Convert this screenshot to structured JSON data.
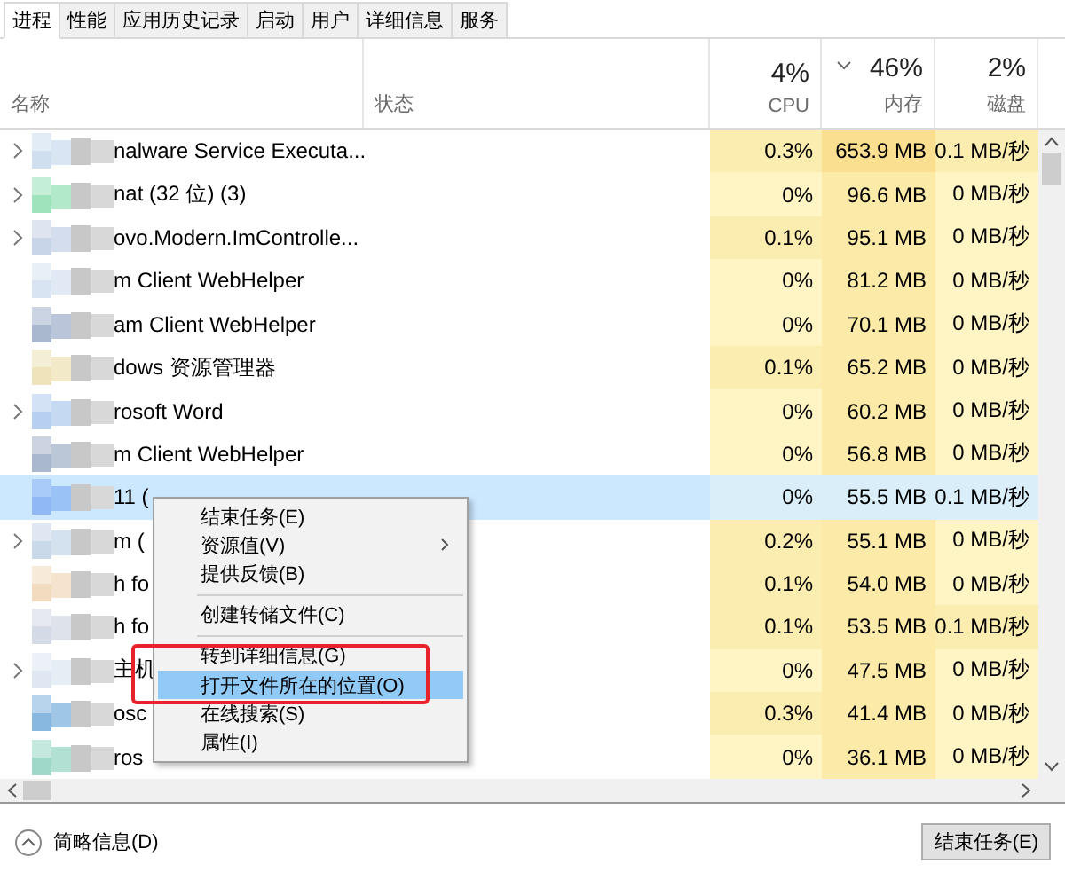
{
  "tabs": [
    {
      "label": "进程",
      "selected": true
    },
    {
      "label": "性能",
      "selected": false
    },
    {
      "label": "应用历史记录",
      "selected": false
    },
    {
      "label": "启动",
      "selected": false
    },
    {
      "label": "用户",
      "selected": false
    },
    {
      "label": "详细信息",
      "selected": false
    },
    {
      "label": "服务",
      "selected": false
    }
  ],
  "columns": {
    "name": "名称",
    "status": "状态",
    "metrics": [
      {
        "percent": "4%",
        "label": "CPU",
        "sorted": false
      },
      {
        "percent": "46%",
        "label": "内存",
        "sorted": true
      },
      {
        "percent": "2%",
        "label": "磁盘",
        "sorted": false
      }
    ]
  },
  "rows": [
    {
      "expandable": true,
      "name": "nalware Service Executa...",
      "selected": false,
      "cpu": "0.3%",
      "memory": "653.9 MB",
      "disk": "0.1 MB/秒"
    },
    {
      "expandable": true,
      "name": "nat (32 位) (3)",
      "selected": false,
      "cpu": "0%",
      "memory": "96.6 MB",
      "disk": "0 MB/秒"
    },
    {
      "expandable": true,
      "name": "ovo.Modern.ImControlle...",
      "selected": false,
      "cpu": "0.1%",
      "memory": "95.1 MB",
      "disk": "0 MB/秒"
    },
    {
      "expandable": false,
      "name": "m Client WebHelper",
      "selected": false,
      "cpu": "0%",
      "memory": "81.2 MB",
      "disk": "0 MB/秒"
    },
    {
      "expandable": false,
      "name": "am Client WebHelper",
      "selected": false,
      "cpu": "0%",
      "memory": "70.1 MB",
      "disk": "0 MB/秒"
    },
    {
      "expandable": false,
      "name": "dows 资源管理器",
      "selected": false,
      "cpu": "0.1%",
      "memory": "65.2 MB",
      "disk": "0 MB/秒"
    },
    {
      "expandable": true,
      "name": "rosoft Word",
      "selected": false,
      "cpu": "0%",
      "memory": "60.2 MB",
      "disk": "0 MB/秒"
    },
    {
      "expandable": false,
      "name": "m Client WebHelper",
      "selected": false,
      "cpu": "0%",
      "memory": "56.8 MB",
      "disk": "0 MB/秒"
    },
    {
      "expandable": false,
      "name": "11 (",
      "selected": true,
      "cpu": "0%",
      "memory": "55.5 MB",
      "disk": "0.1 MB/秒"
    },
    {
      "expandable": true,
      "name": "m (",
      "selected": false,
      "cpu": "0.2%",
      "memory": "55.1 MB",
      "disk": "0 MB/秒"
    },
    {
      "expandable": false,
      "name": "h fo",
      "selected": false,
      "cpu": "0.1%",
      "memory": "54.0 MB",
      "disk": "0 MB/秒"
    },
    {
      "expandable": false,
      "name": "h fo",
      "selected": false,
      "cpu": "0.1%",
      "memory": "53.5 MB",
      "disk": "0.1 MB/秒"
    },
    {
      "expandable": true,
      "name": "主机",
      "selected": false,
      "cpu": "0%",
      "memory": "47.5 MB",
      "disk": "0 MB/秒"
    },
    {
      "expandable": false,
      "name": "osc",
      "selected": false,
      "cpu": "0.3%",
      "memory": "41.4 MB",
      "disk": "0 MB/秒"
    },
    {
      "expandable": false,
      "name": "ros",
      "selected": false,
      "cpu": "0%",
      "memory": "36.1 MB",
      "disk": "0 MB/秒"
    }
  ],
  "context_menu": [
    {
      "kind": "item",
      "label": "结束任务(E)",
      "selected": false,
      "submenu": false,
      "marked": false
    },
    {
      "kind": "item",
      "label": "资源值(V)",
      "selected": false,
      "submenu": true,
      "marked": false
    },
    {
      "kind": "item",
      "label": "提供反馈(B)",
      "selected": false,
      "submenu": false,
      "marked": false
    },
    {
      "kind": "separator"
    },
    {
      "kind": "item",
      "label": "创建转储文件(C)",
      "selected": false,
      "submenu": false,
      "marked": false
    },
    {
      "kind": "separator"
    },
    {
      "kind": "item",
      "label": "转到详细信息(G)",
      "selected": false,
      "submenu": false,
      "marked": false
    },
    {
      "kind": "item",
      "label": "打开文件所在的位置(O)",
      "selected": true,
      "submenu": false,
      "marked": true
    },
    {
      "kind": "item",
      "label": "在线搜索(S)",
      "selected": false,
      "submenu": false,
      "marked": false
    },
    {
      "kind": "item",
      "label": "属性(I)",
      "selected": false,
      "submenu": false,
      "marked": false
    }
  ],
  "footer": {
    "details_toggle": "简略信息(D)",
    "end_task_button": "结束任务(E)"
  }
}
